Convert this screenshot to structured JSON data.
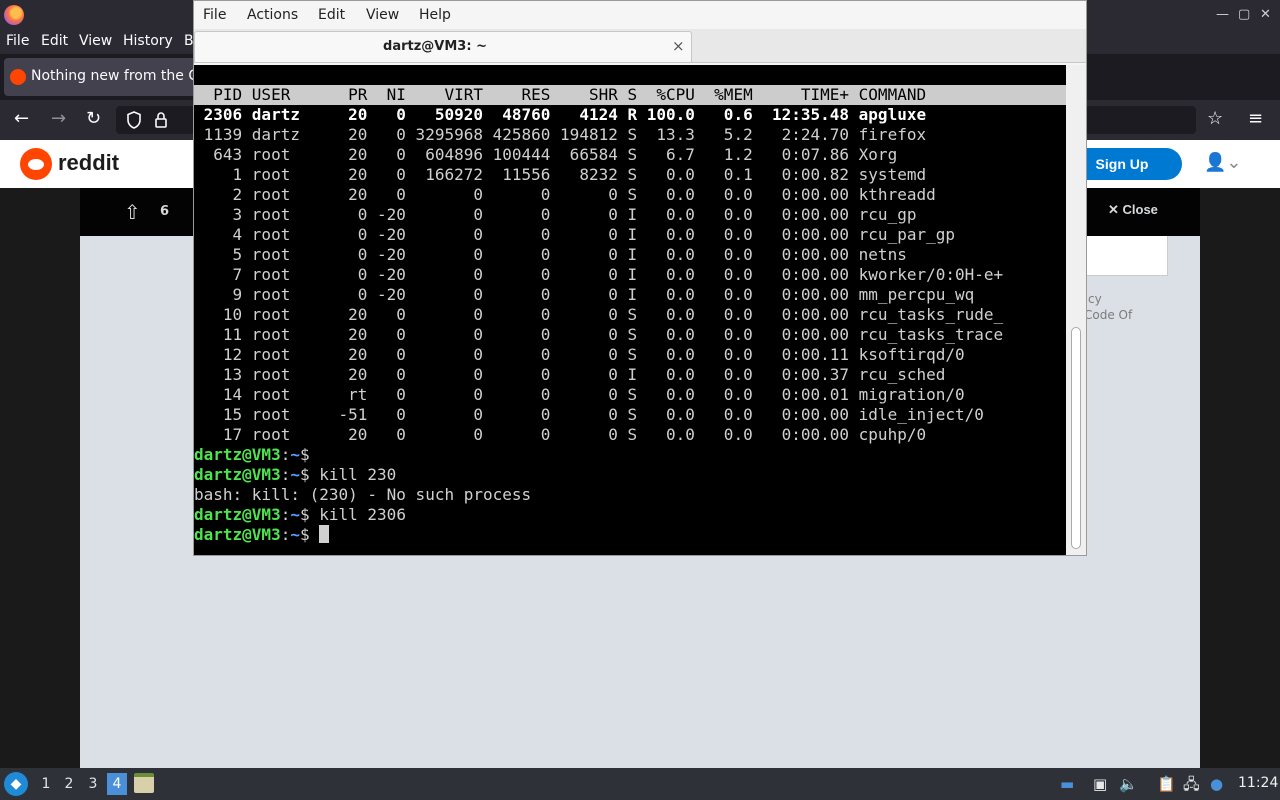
{
  "firefox": {
    "window_controls": [
      "—",
      "▢",
      "✕"
    ],
    "menus": [
      "File",
      "Edit",
      "View",
      "History",
      "B"
    ],
    "tab_title": "Nothing new from the C",
    "nav": {
      "back": "←",
      "forward": "→",
      "reload": "↻",
      "star": "☆",
      "menu": "≡"
    }
  },
  "reddit": {
    "wordmark": "reddit",
    "signup_label": "Sign Up",
    "vote_count": "6",
    "close_label": "Close",
    "policy_text_1": "cy",
    "policy_text_2": "Code Of"
  },
  "terminal": {
    "menus": [
      "File",
      "Actions",
      "Edit",
      "View",
      "Help"
    ],
    "tab_title": "dartz@VM3: ~",
    "tab_close": "×",
    "top_header": "  PID USER      PR  NI    VIRT    RES    SHR S  %CPU  %MEM     TIME+ COMMAND",
    "processes": [
      {
        "pid": "2306",
        "user": "dartz",
        "pr": "20",
        "ni": "0",
        "virt": "50920",
        "res": "48760",
        "shr": "4124",
        "s": "R",
        "cpu": "100.0",
        "mem": "0.6",
        "time": "12:35.48",
        "cmd": "apgluxe",
        "bold": true
      },
      {
        "pid": "1139",
        "user": "dartz",
        "pr": "20",
        "ni": "0",
        "virt": "3295968",
        "res": "425860",
        "shr": "194812",
        "s": "S",
        "cpu": "13.3",
        "mem": "5.2",
        "time": "2:24.70",
        "cmd": "firefox"
      },
      {
        "pid": "643",
        "user": "root",
        "pr": "20",
        "ni": "0",
        "virt": "604896",
        "res": "100444",
        "shr": "66584",
        "s": "S",
        "cpu": "6.7",
        "mem": "1.2",
        "time": "0:07.86",
        "cmd": "Xorg"
      },
      {
        "pid": "1",
        "user": "root",
        "pr": "20",
        "ni": "0",
        "virt": "166272",
        "res": "11556",
        "shr": "8232",
        "s": "S",
        "cpu": "0.0",
        "mem": "0.1",
        "time": "0:00.82",
        "cmd": "systemd"
      },
      {
        "pid": "2",
        "user": "root",
        "pr": "20",
        "ni": "0",
        "virt": "0",
        "res": "0",
        "shr": "0",
        "s": "S",
        "cpu": "0.0",
        "mem": "0.0",
        "time": "0:00.00",
        "cmd": "kthreadd"
      },
      {
        "pid": "3",
        "user": "root",
        "pr": "0",
        "ni": "-20",
        "virt": "0",
        "res": "0",
        "shr": "0",
        "s": "I",
        "cpu": "0.0",
        "mem": "0.0",
        "time": "0:00.00",
        "cmd": "rcu_gp"
      },
      {
        "pid": "4",
        "user": "root",
        "pr": "0",
        "ni": "-20",
        "virt": "0",
        "res": "0",
        "shr": "0",
        "s": "I",
        "cpu": "0.0",
        "mem": "0.0",
        "time": "0:00.00",
        "cmd": "rcu_par_gp"
      },
      {
        "pid": "5",
        "user": "root",
        "pr": "0",
        "ni": "-20",
        "virt": "0",
        "res": "0",
        "shr": "0",
        "s": "I",
        "cpu": "0.0",
        "mem": "0.0",
        "time": "0:00.00",
        "cmd": "netns"
      },
      {
        "pid": "7",
        "user": "root",
        "pr": "0",
        "ni": "-20",
        "virt": "0",
        "res": "0",
        "shr": "0",
        "s": "I",
        "cpu": "0.0",
        "mem": "0.0",
        "time": "0:00.00",
        "cmd": "kworker/0:0H-e+"
      },
      {
        "pid": "9",
        "user": "root",
        "pr": "0",
        "ni": "-20",
        "virt": "0",
        "res": "0",
        "shr": "0",
        "s": "I",
        "cpu": "0.0",
        "mem": "0.0",
        "time": "0:00.00",
        "cmd": "mm_percpu_wq"
      },
      {
        "pid": "10",
        "user": "root",
        "pr": "20",
        "ni": "0",
        "virt": "0",
        "res": "0",
        "shr": "0",
        "s": "S",
        "cpu": "0.0",
        "mem": "0.0",
        "time": "0:00.00",
        "cmd": "rcu_tasks_rude_"
      },
      {
        "pid": "11",
        "user": "root",
        "pr": "20",
        "ni": "0",
        "virt": "0",
        "res": "0",
        "shr": "0",
        "s": "S",
        "cpu": "0.0",
        "mem": "0.0",
        "time": "0:00.00",
        "cmd": "rcu_tasks_trace"
      },
      {
        "pid": "12",
        "user": "root",
        "pr": "20",
        "ni": "0",
        "virt": "0",
        "res": "0",
        "shr": "0",
        "s": "S",
        "cpu": "0.0",
        "mem": "0.0",
        "time": "0:00.11",
        "cmd": "ksoftirqd/0"
      },
      {
        "pid": "13",
        "user": "root",
        "pr": "20",
        "ni": "0",
        "virt": "0",
        "res": "0",
        "shr": "0",
        "s": "I",
        "cpu": "0.0",
        "mem": "0.0",
        "time": "0:00.37",
        "cmd": "rcu_sched"
      },
      {
        "pid": "14",
        "user": "root",
        "pr": "rt",
        "ni": "0",
        "virt": "0",
        "res": "0",
        "shr": "0",
        "s": "S",
        "cpu": "0.0",
        "mem": "0.0",
        "time": "0:00.01",
        "cmd": "migration/0"
      },
      {
        "pid": "15",
        "user": "root",
        "pr": "-51",
        "ni": "0",
        "virt": "0",
        "res": "0",
        "shr": "0",
        "s": "S",
        "cpu": "0.0",
        "mem": "0.0",
        "time": "0:00.00",
        "cmd": "idle_inject/0"
      },
      {
        "pid": "17",
        "user": "root",
        "pr": "20",
        "ni": "0",
        "virt": "0",
        "res": "0",
        "shr": "0",
        "s": "S",
        "cpu": "0.0",
        "mem": "0.0",
        "time": "0:00.00",
        "cmd": "cpuhp/0"
      }
    ],
    "prompt_user": "dartz@VM3",
    "prompt_path": "~",
    "session": [
      {
        "type": "prompt",
        "cmd": ""
      },
      {
        "type": "prompt",
        "cmd": "kill 230"
      },
      {
        "type": "output",
        "text": "bash: kill: (230) - No such process"
      },
      {
        "type": "prompt",
        "cmd": "kill 2306"
      },
      {
        "type": "prompt",
        "cmd": "",
        "cursor": true
      }
    ]
  },
  "taskbar": {
    "workspaces": [
      "1",
      "2",
      "3",
      "4"
    ],
    "active_workspace": "4",
    "clock": "11:24",
    "tray_icons": [
      "display-icon",
      "battery-icon",
      "volume-icon",
      "clipboard-icon",
      "network-icon",
      "notification-icon"
    ]
  }
}
